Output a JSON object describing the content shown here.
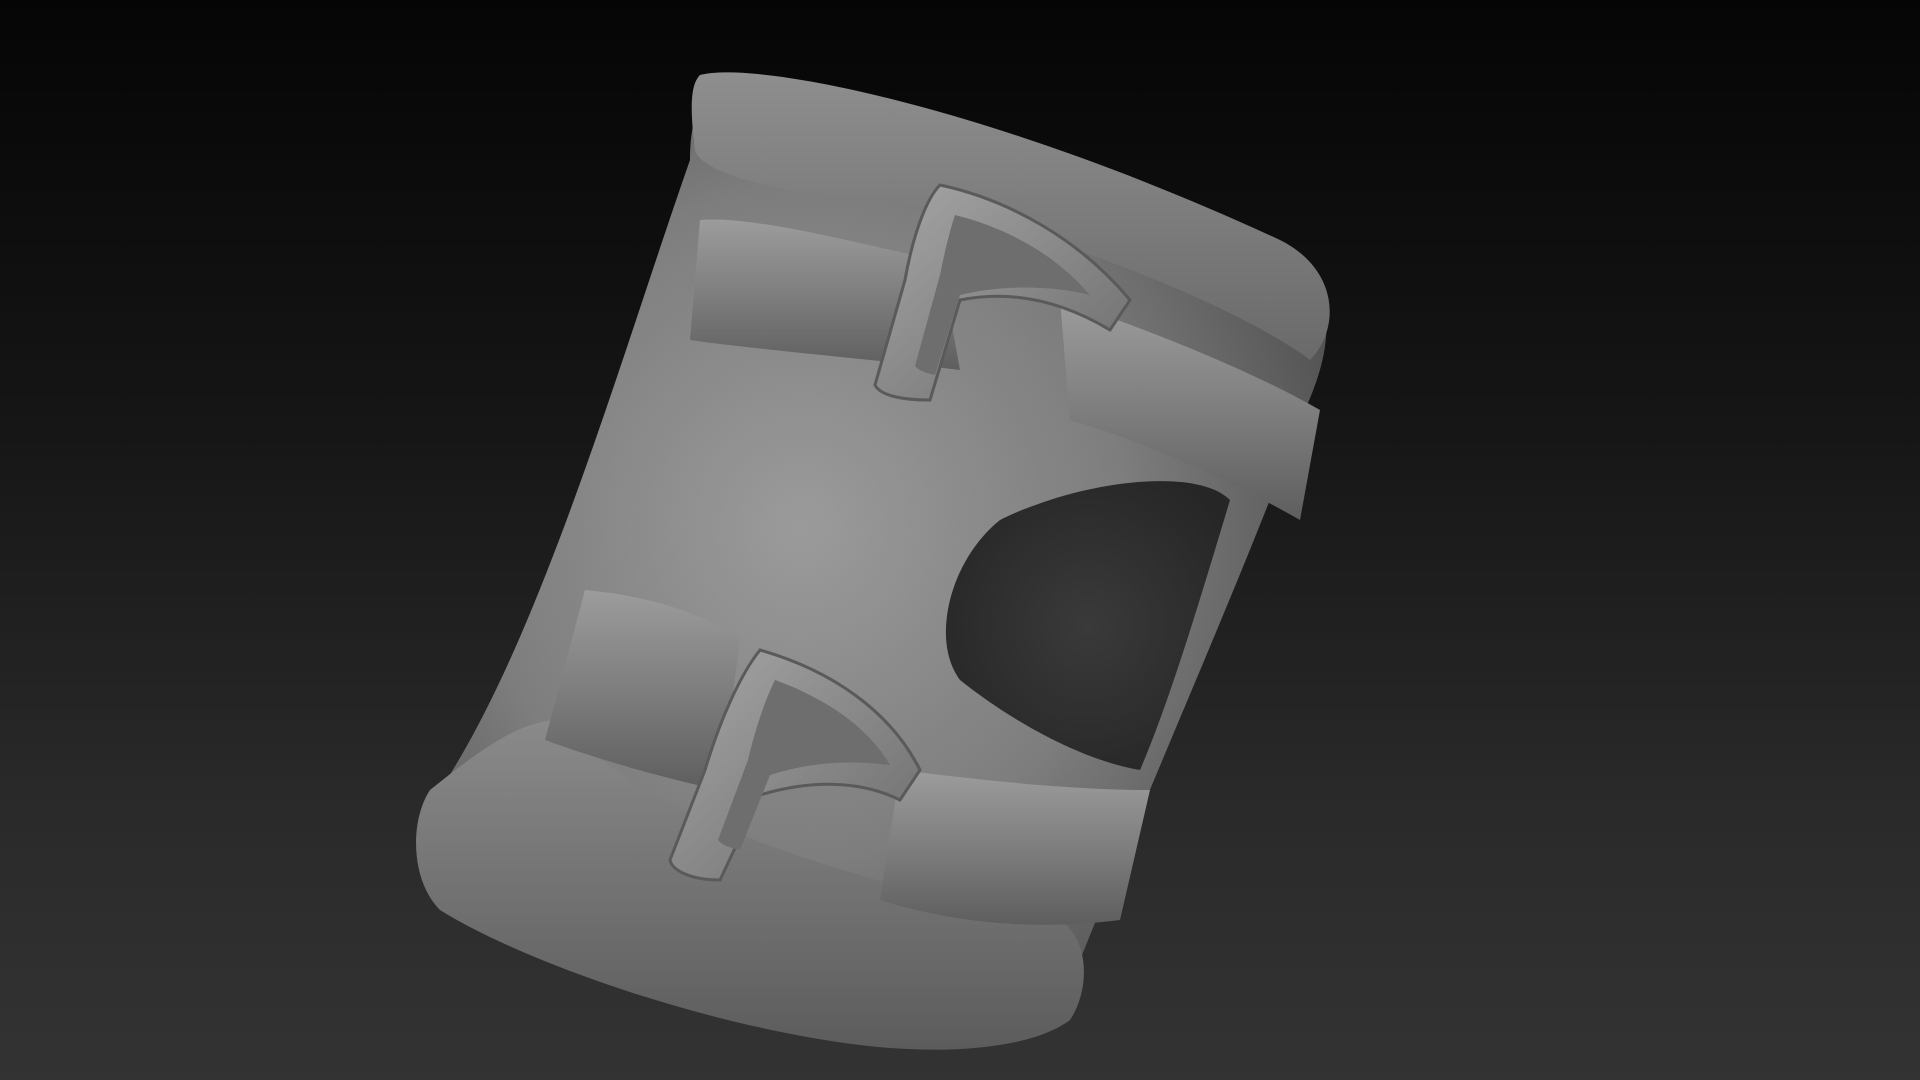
{
  "viewport": {
    "background_top": "#050505",
    "background_bottom": "#333333"
  },
  "model": {
    "subject": "leather-bracer",
    "material_color": "#808080",
    "strap_count": 2,
    "buckle_count": 2
  }
}
